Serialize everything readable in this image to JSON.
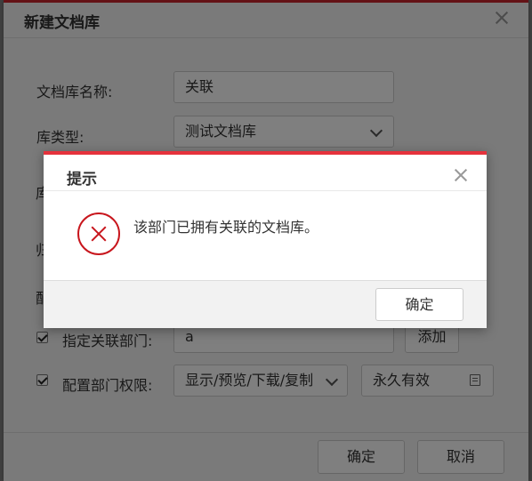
{
  "outer_dialog": {
    "title": "新建文档库",
    "fields": {
      "name_label": "文档库名称:",
      "name_value": "关联",
      "type_label": "库类型:",
      "type_value": "测试文档库",
      "partial_char_1": "库",
      "partial_char_2": "归",
      "partial_char_3": "配",
      "dept_label": "指定关联部门:",
      "dept_value": "a",
      "add_button": "添加",
      "perm_label": "配置部门权限:",
      "perm_value": "显示/预览/下载/复制",
      "expiry_value": "永久有效"
    },
    "footer": {
      "confirm": "确定",
      "cancel": "取消"
    }
  },
  "modal": {
    "title": "提示",
    "message": "该部门已拥有关联的文档库。",
    "ok_button": "确定"
  },
  "colors": {
    "accent_red": "#e5323c",
    "error_red": "#c8161d"
  }
}
